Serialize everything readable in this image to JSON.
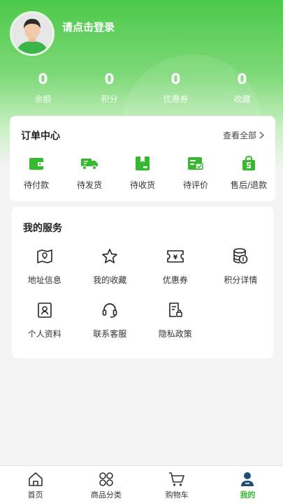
{
  "colors": {
    "brand_green": "#4cc94a",
    "accent_green": "#36b82f",
    "active_tab_icon": "#1d4e78"
  },
  "profile": {
    "login_prompt": "请点击登录"
  },
  "stats": [
    {
      "value": "0",
      "label": "余额"
    },
    {
      "value": "0",
      "label": "积分"
    },
    {
      "value": "0",
      "label": "优惠券"
    },
    {
      "value": "0",
      "label": "收藏"
    }
  ],
  "order_center": {
    "title": "订单中心",
    "view_all": "查看全部",
    "items": [
      {
        "label": "待付款",
        "icon": "wallet-icon"
      },
      {
        "label": "待发货",
        "icon": "truck-icon"
      },
      {
        "label": "待收货",
        "icon": "package-icon"
      },
      {
        "label": "待评价",
        "icon": "review-icon"
      },
      {
        "label": "售后/退款",
        "icon": "shopping-bag-icon"
      }
    ]
  },
  "services": {
    "title": "我的服务",
    "items": [
      {
        "label": "地址信息",
        "icon": "map-icon"
      },
      {
        "label": "我的收藏",
        "icon": "star-icon"
      },
      {
        "label": "优惠券",
        "icon": "coupon-icon"
      },
      {
        "label": "积分详情",
        "icon": "coins-icon"
      },
      {
        "label": "个人资料",
        "icon": "id-card-icon"
      },
      {
        "label": "联系客服",
        "icon": "headset-icon"
      },
      {
        "label": "隐私政策",
        "icon": "privacy-doc-icon"
      }
    ]
  },
  "tabbar": {
    "active": "我的",
    "tabs": [
      {
        "label": "首页",
        "icon": "home-icon"
      },
      {
        "label": "商品分类",
        "icon": "category-icon"
      },
      {
        "label": "购物车",
        "icon": "cart-icon"
      },
      {
        "label": "我的",
        "icon": "user-icon"
      }
    ]
  }
}
